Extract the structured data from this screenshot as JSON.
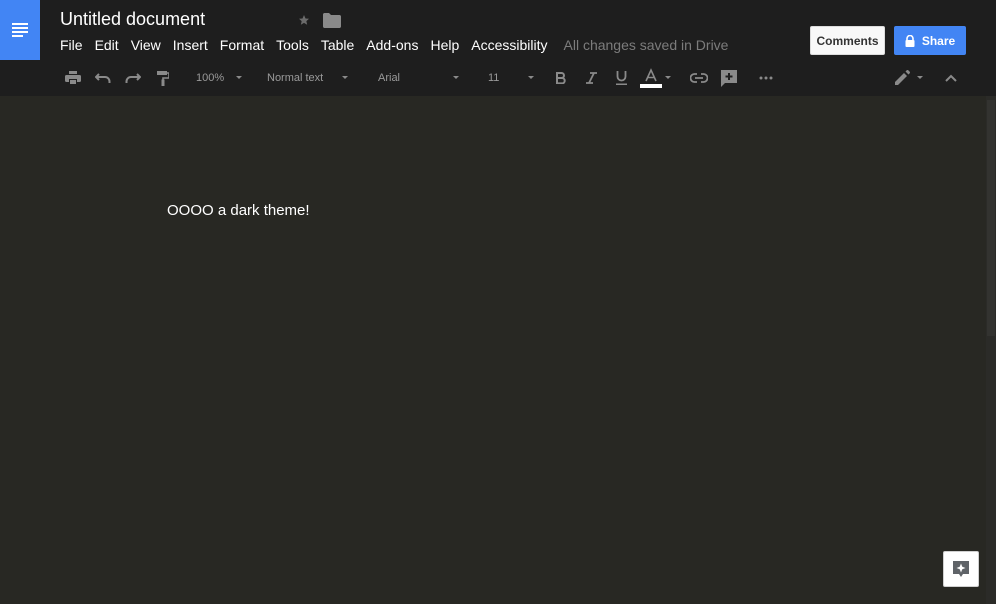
{
  "app": {
    "doc_title": "Untitled document",
    "save_status": "All changes saved in Drive",
    "logo_icon": "docs-icon",
    "accent_color": "#4285f4",
    "theme": "dark"
  },
  "menu": {
    "items": [
      "File",
      "Edit",
      "View",
      "Insert",
      "Format",
      "Tools",
      "Table",
      "Add-ons",
      "Help",
      "Accessibility"
    ]
  },
  "buttons": {
    "comments_label": "Comments",
    "share_label": "Share"
  },
  "toolbar": {
    "zoom": "100%",
    "style": "Normal text",
    "font": "Arial",
    "font_size": "11",
    "text_color_label": "A",
    "icons": [
      "print-icon",
      "undo-icon",
      "redo-icon",
      "paint-format-icon",
      "bold-icon",
      "italic-icon",
      "underline-icon",
      "text-color-icon",
      "link-icon",
      "add-comment-icon",
      "more-icon",
      "edit-mode-icon",
      "collapse-icon"
    ]
  },
  "document": {
    "body_text": "OOOO a dark theme!"
  }
}
